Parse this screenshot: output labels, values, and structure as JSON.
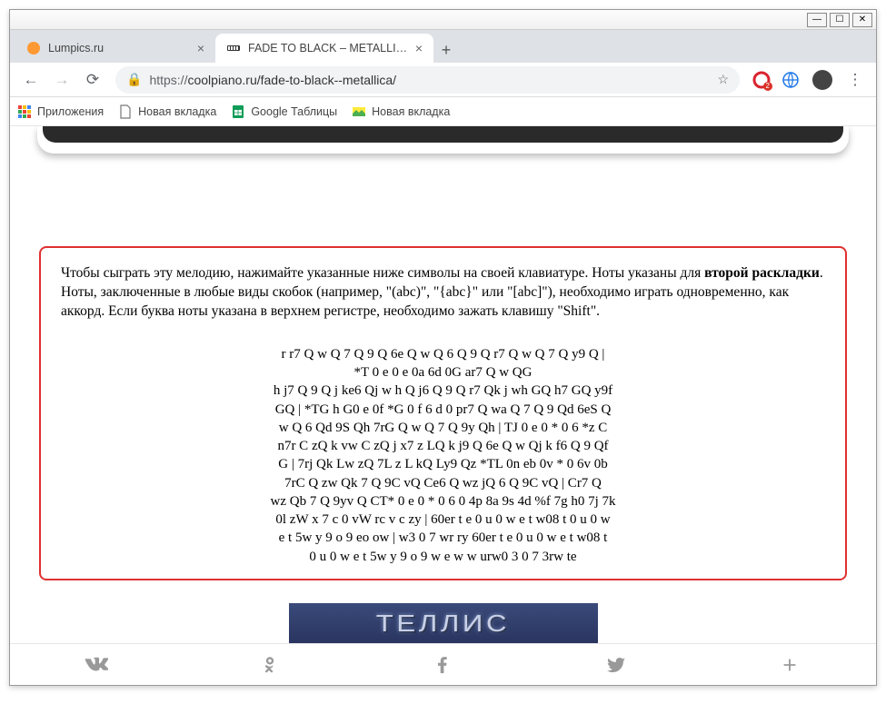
{
  "window": {
    "min": "—",
    "max": "☐",
    "close": "✕"
  },
  "tabs": [
    {
      "title": "Lumpics.ru",
      "active": false
    },
    {
      "title": "FADE TO BLACK – METALLICA. Н",
      "active": true
    }
  ],
  "toolbar": {
    "url_scheme": "https://",
    "url_rest": "coolpiano.ru/fade-to-black--metallica/",
    "badge": "2"
  },
  "bookmarks": [
    {
      "label": "Приложения",
      "icon": "apps"
    },
    {
      "label": "Новая вкладка",
      "icon": "page"
    },
    {
      "label": "Google Таблицы",
      "icon": "sheets"
    },
    {
      "label": "Новая вкладка",
      "icon": "image"
    }
  ],
  "page": {
    "instruction_pre": "Чтобы сыграть эту мелодию, нажимайте указанные ниже символы на своей клавиатуре. Ноты указаны для ",
    "instruction_bold": "второй раскладки",
    "instruction_post": ". Ноты, заключенные в любые виды скобок (например, \"(abc)\", \"{abc}\" или \"[abc]\"), необходимо играть одновременно, как аккорд. Если буква ноты указана в верхнем регистре, необходимо зажать клавишу \"Shift\".",
    "notes": "r r7 Q w Q 7 Q 9 Q 6e Q w Q 6 Q 9 Q r7 Q w Q 7 Q y9 Q |\n*T 0 e 0 e 0a 6d 0G ar7 Q w QG\nh j7 Q 9 Q j ke6 Qj w h Q j6 Q 9 Q r7 Qk j wh GQ h7 GQ y9f\nGQ | *TG h G0 e 0f *G 0 f 6 d 0 pr7 Q wa Q 7 Q 9 Qd 6eS Q\nw Q 6 Qd 9S Qh 7rG Q w Q 7 Q 9y Qh | TJ 0 e 0 * 0 6 *z C\nn7r C zQ k vw C zQ j x7 z LQ k j9 Q 6e Q w Qj k f6 Q 9 Qf\nG | 7rj Qk Lw zQ 7L z L kQ Ly9 Qz *TL 0n eb 0v * 0 6v 0b\n7rC Q zw Qk 7 Q 9C vQ Ce6 Q wz jQ 6 Q 9C vQ | Cr7 Q\nwz Qb 7 Q 9yv Q CT* 0 e 0 * 0 6 0 4p 8a 9s 4d %f 7g h0 7j 7k\n0l zW x 7 c 0 vW rc v c zy | 60er t e 0 u 0 w e t w08 t 0 u 0 w\ne t 5w y 9 o 9 eo ow | w3 0 7 wr ry 60er t e 0 u 0 w e t w08 t\n0 u 0 w e t 5w y 9 o 9 w e w w urw0 3 0 7 3rw te",
    "album_text": "ТЕЛЛИС"
  }
}
